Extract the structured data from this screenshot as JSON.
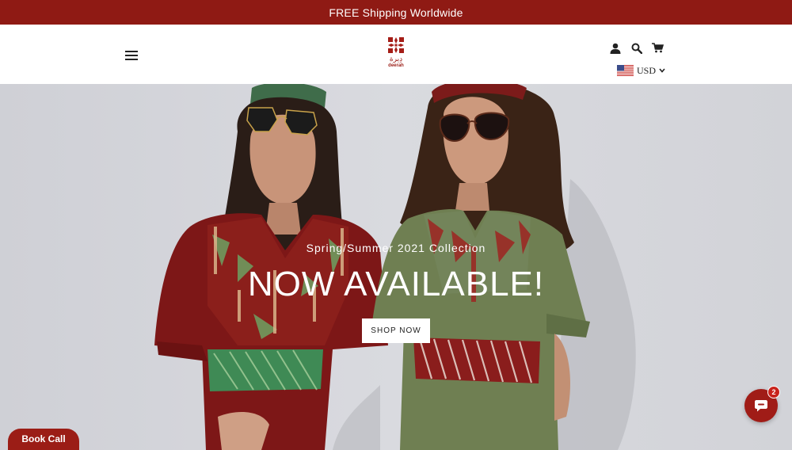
{
  "announcement": {
    "text": "FREE Shipping Worldwide"
  },
  "header": {
    "logo": {
      "arabic": "دِيرة",
      "latin": "deerah"
    },
    "currency": {
      "code": "USD"
    }
  },
  "hero": {
    "subtitle": "Spring/Summer 2021 Collection",
    "title": "NOW AVAILABLE!",
    "cta_label": "SHOP NOW"
  },
  "book_call": {
    "label": "Book Call"
  },
  "chat": {
    "badge_count": "2"
  },
  "colors": {
    "brand": "#8f1a14",
    "dress_red": "#7d1717",
    "dress_green": "#6f7f52"
  },
  "icons": [
    "hamburger-menu-icon",
    "account-icon",
    "search-icon",
    "cart-icon",
    "us-flag-icon",
    "chevron-down-icon",
    "chat-icon"
  ]
}
